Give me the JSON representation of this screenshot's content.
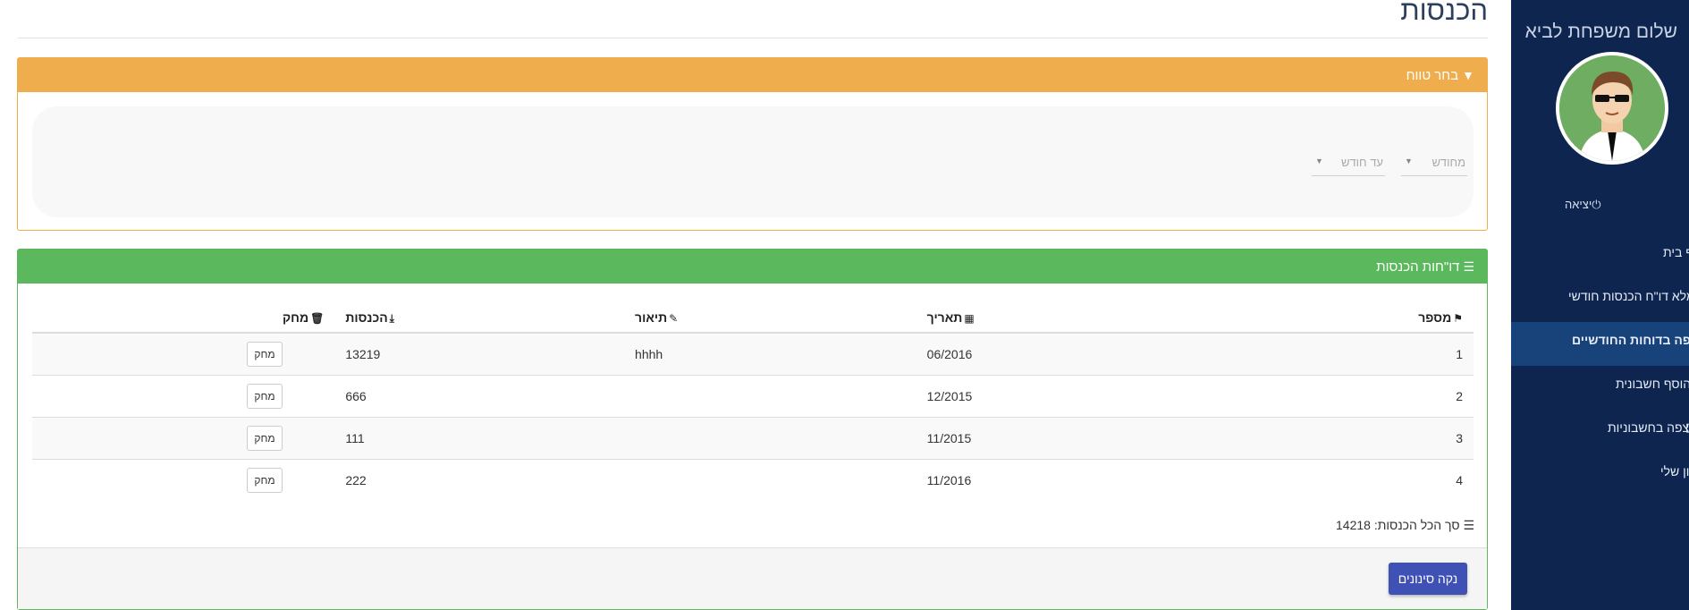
{
  "colors": {
    "sidebar": "#0e2550",
    "sidebar_active": "#17427a",
    "filter_header": "#f0ad4e",
    "report_header": "#5cb85c",
    "primary_button": "#3f51b5"
  },
  "sidebar": {
    "greeting": "שלום משפחת לביא",
    "logout": "יציאה",
    "items": [
      {
        "label": "דף בית",
        "icon": "home-icon",
        "active": false
      },
      {
        "label": "מלא דו\"ח הכנסות חודשי",
        "icon": "form-icon",
        "active": false
      },
      {
        "label": "צפה בדוחות החודשיים",
        "icon": "scale-icon",
        "active": true
      },
      {
        "label": "הוסף חשבונית",
        "icon": "plus-icon",
        "active": false
      },
      {
        "label": "צפה בחשבוניות",
        "icon": "receipt-icon",
        "active": false
      },
      {
        "label": "החשבון שלי",
        "icon": "user-icon",
        "active": false
      }
    ]
  },
  "page": {
    "title": "הכנסות"
  },
  "filter": {
    "title": "בחר טווח",
    "from_placeholder": "מחודש",
    "to_placeholder": "עד חודש"
  },
  "report": {
    "title": "דו\"חות הכנסות",
    "columns": [
      "מספר",
      "תאריך",
      "תיאור",
      "הכנסות",
      "מחק"
    ],
    "rows": [
      {
        "num": "1",
        "date": "06/2016",
        "desc": "hhhh",
        "income": "13219",
        "delete": "מחק"
      },
      {
        "num": "2",
        "date": "12/2015",
        "desc": "",
        "income": "666",
        "delete": "מחק"
      },
      {
        "num": "3",
        "date": "11/2015",
        "desc": "",
        "income": "111",
        "delete": "מחק"
      },
      {
        "num": "4",
        "date": "11/2016",
        "desc": "",
        "income": "222",
        "delete": "מחק"
      }
    ],
    "total_label": "סך הכל הכנסות:",
    "total_value": "14218",
    "clear_button": "נקה סינונים"
  }
}
